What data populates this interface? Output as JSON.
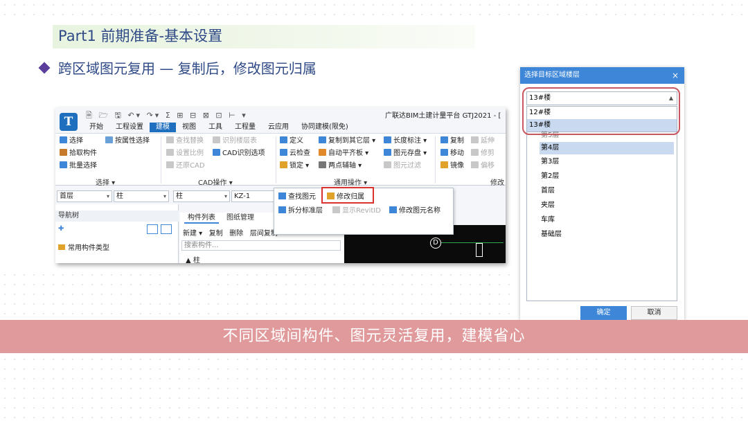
{
  "slide": {
    "title": "Part1 前期准备-基本设置",
    "bullet": "跨区域图元复用 — 复制后，修改图元归属",
    "banner": "不同区域间构件、图元灵活复用，建模省心"
  },
  "app": {
    "logo": "T",
    "window_title": "广联达BIM土建计量平台 GTJ2021 - [",
    "quick_access": "🗎 🗁 🖫 ↶▾ ↷▾ Σ ⊞ ⊟ ⊠ ⊡ ⊢ ▾",
    "tabs": [
      "开始",
      "工程设置",
      "建模",
      "视图",
      "工具",
      "工程量",
      "云应用",
      "协同建模(限免)"
    ],
    "active_tab": "建模",
    "ribbon": {
      "select_group": {
        "label": "选择 ▾",
        "items": [
          "选择",
          "按属性选择",
          "拾取构件",
          "批量选择"
        ]
      },
      "cad_group": {
        "label": "CAD操作 ▾",
        "items": [
          "查找替换",
          "识别楼层表",
          "设置比例",
          "CAD识别选项",
          "还原CAD"
        ]
      },
      "general_group": {
        "label": "通用操作 ▾",
        "items": [
          "定义",
          "复制到其它层 ▾",
          "长度标注 ▾",
          "云检查",
          "自动平齐板 ▾",
          "图元存盘 ▾",
          "锁定 ▾",
          "两点辅轴 ▾",
          "图元过滤"
        ]
      },
      "modify_group": {
        "label": "修改",
        "items": [
          "复制",
          "延伸",
          "移动",
          "修剪",
          "镜像",
          "偏移"
        ]
      }
    },
    "selectors": [
      "首层",
      "柱",
      "柱",
      "KZ-1"
    ],
    "dropdown_menu": {
      "items": [
        "查找图元",
        "修改归属",
        "拆分标准层",
        "显示RevitID",
        "修改图元名称"
      ],
      "highlighted": "修改归属"
    },
    "nav_tree": {
      "title": "导航树",
      "item": "常用构件类型"
    },
    "component_panel": {
      "tabs": [
        "构件列表",
        "图纸管理"
      ],
      "toolbar": [
        "新建 ▾",
        "复制",
        "删除",
        "层间复制"
      ],
      "search_placeholder": "搜索构件...",
      "row": "▲ 柱"
    },
    "canvas_label": "D"
  },
  "dialog": {
    "title": "选择目标区域楼层",
    "close": "×",
    "combo_value": "13#楼",
    "combo_options": [
      "12#楼",
      "13#楼"
    ],
    "combo_selected": "13#楼",
    "floors": [
      "第5层",
      "第4层",
      "第3层",
      "第2层",
      "首层",
      "夹层",
      "车库",
      "基础层"
    ],
    "selected_floor": "第4层",
    "ok": "确定",
    "cancel": "取消"
  }
}
